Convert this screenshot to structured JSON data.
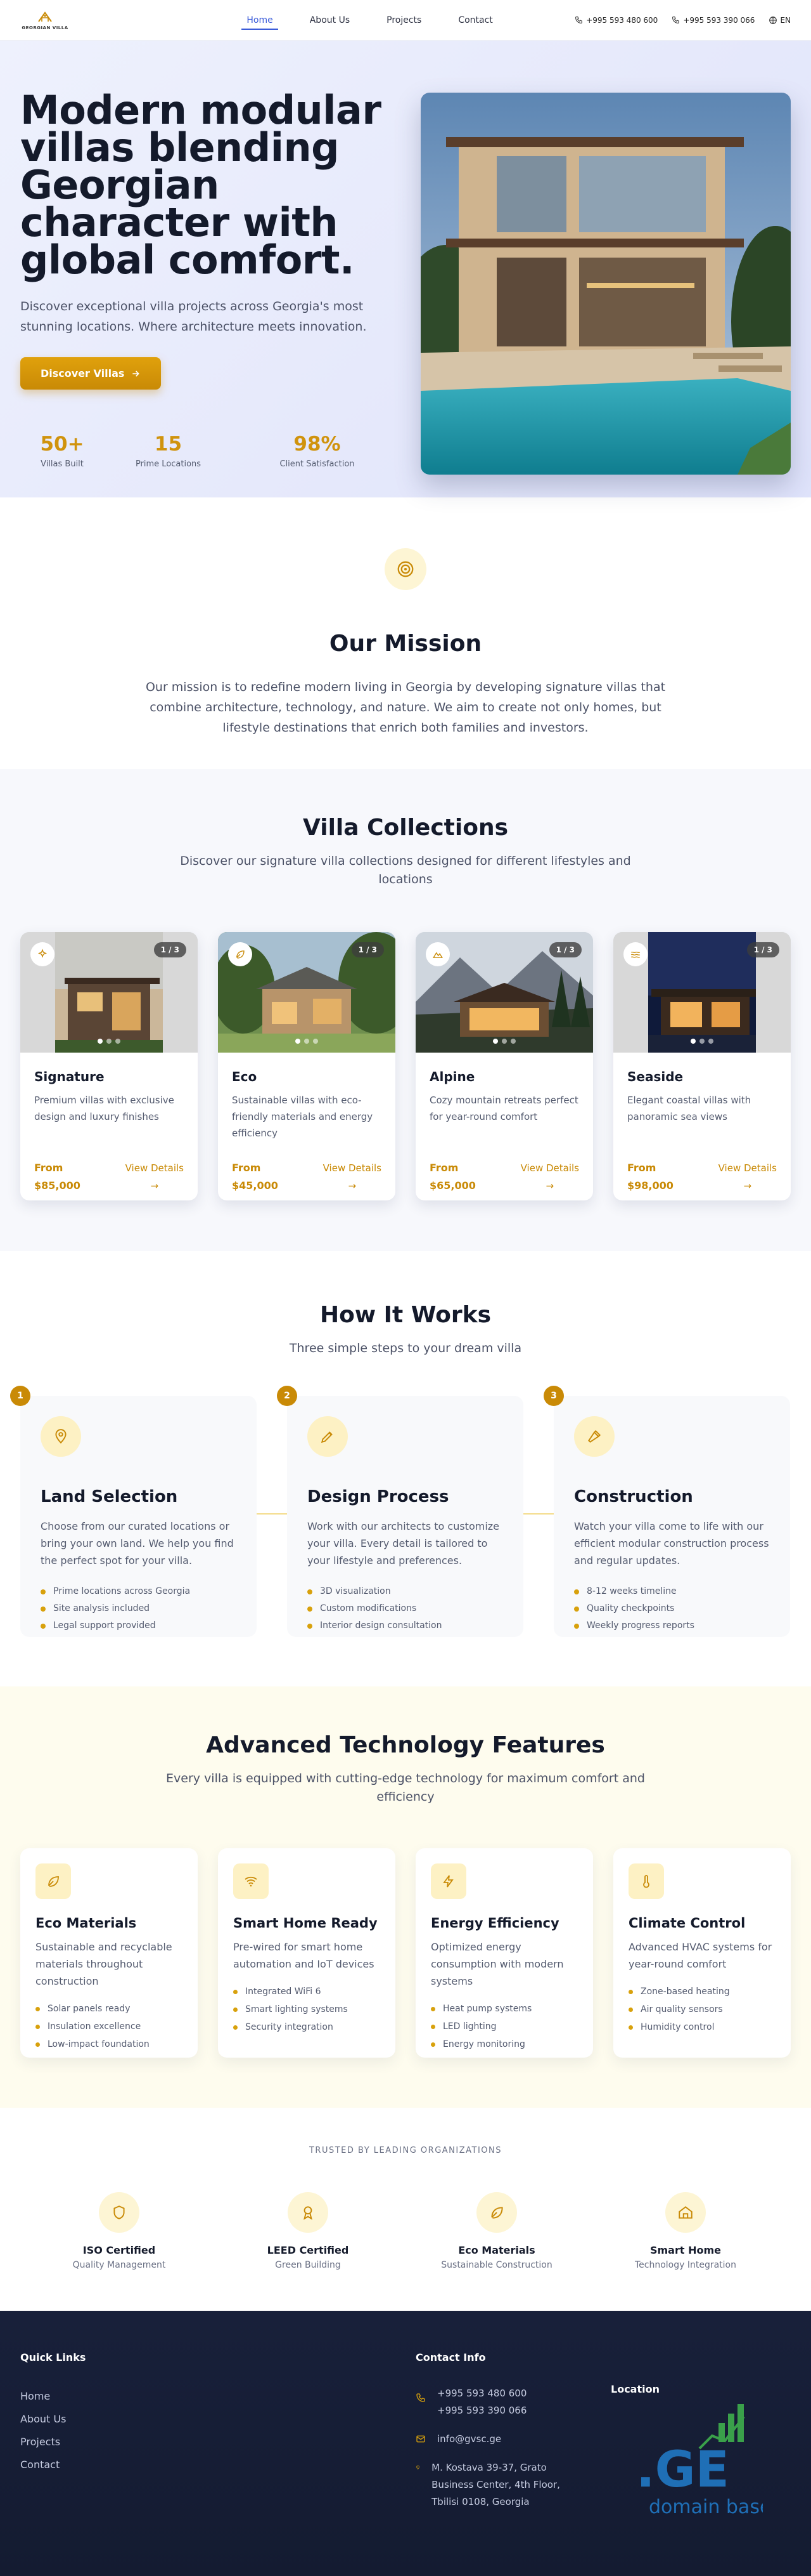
{
  "header": {
    "logo_text": "GEORGIAN VILLA",
    "nav": [
      {
        "label": "Home",
        "active": true
      },
      {
        "label": "About Us",
        "active": false
      },
      {
        "label": "Projects",
        "active": false
      },
      {
        "label": "Contact",
        "active": false
      }
    ],
    "phones": [
      "+995 593 480 600",
      "+995 593 390 066"
    ],
    "language": "EN"
  },
  "hero": {
    "title": "Modern modular villas blending Georgian character with global comfort.",
    "subtitle": "Discover exceptional villa projects across Georgia's most stunning locations. Where architecture meets innovation.",
    "cta_label": "Discover Villas",
    "stats": [
      {
        "value": "50+",
        "label": "Villas Built"
      },
      {
        "value": "15",
        "label": "Prime Locations"
      },
      {
        "value": "98%",
        "label": "Client Satisfaction"
      }
    ]
  },
  "mission": {
    "title": "Our Mission",
    "text": "Our mission is to redefine modern living in Georgia by developing signature villas that combine architecture, technology, and nature. We aim to create not only homes, but lifestyle destinations that enrich both families and investors."
  },
  "collections": {
    "title": "Villa Collections",
    "subtitle": "Discover our signature villa collections designed for different lifestyles and locations",
    "cards": [
      {
        "name": "Signature",
        "description": "Premium villas with exclusive design and luxury finishes",
        "price_label": "From",
        "price": "$85,000",
        "details_label": "View Details",
        "counter": "1 / 3",
        "icon": "sparkles-icon"
      },
      {
        "name": "Eco",
        "description": "Sustainable villas with eco-friendly materials and energy efficiency",
        "price_label": "From",
        "price": "$45,000",
        "details_label": "View Details",
        "counter": "1 / 3",
        "icon": "leaf-icon"
      },
      {
        "name": "Alpine",
        "description": "Cozy mountain retreats perfect for year-round comfort",
        "price_label": "From",
        "price": "$65,000",
        "details_label": "View Details",
        "counter": "1 / 3",
        "icon": "mountain-icon"
      },
      {
        "name": "Seaside",
        "description": "Elegant coastal villas with panoramic sea views",
        "price_label": "From",
        "price": "$98,000",
        "details_label": "View Details",
        "counter": "1 / 3",
        "icon": "waves-icon"
      }
    ]
  },
  "how": {
    "title": "How It Works",
    "subtitle": "Three simple steps to your dream villa",
    "steps": [
      {
        "number": "1",
        "title": "Land Selection",
        "description": "Choose from our curated locations or bring your own land. We help you find the perfect spot for your villa.",
        "items": [
          "Prime locations across Georgia",
          "Site analysis included",
          "Legal support provided"
        ],
        "icon": "map-pin-icon"
      },
      {
        "number": "2",
        "title": "Design Process",
        "description": "Work with our architects to customize your villa. Every detail is tailored to your lifestyle and preferences.",
        "items": [
          "3D visualization",
          "Custom modifications",
          "Interior design consultation"
        ],
        "icon": "pen-tool-icon"
      },
      {
        "number": "3",
        "title": "Construction",
        "description": "Watch your villa come to life with our efficient modular construction process and regular updates.",
        "items": [
          "8-12 weeks timeline",
          "Quality checkpoints",
          "Weekly progress reports"
        ],
        "icon": "hammer-icon"
      }
    ]
  },
  "tech": {
    "title": "Advanced Technology Features",
    "subtitle": "Every villa is equipped with cutting-edge technology for maximum comfort and efficiency",
    "cards": [
      {
        "title": "Eco Materials",
        "description": "Sustainable and recyclable materials throughout construction",
        "items": [
          "Solar panels ready",
          "Insulation excellence",
          "Low-impact foundation"
        ],
        "icon": "leaf-icon"
      },
      {
        "title": "Smart Home Ready",
        "description": "Pre-wired for smart home automation and IoT devices",
        "items": [
          "Integrated WiFi 6",
          "Smart lighting systems",
          "Security integration"
        ],
        "icon": "wifi-icon"
      },
      {
        "title": "Energy Efficiency",
        "description": "Optimized energy consumption with modern systems",
        "items": [
          "Heat pump systems",
          "LED lighting",
          "Energy monitoring"
        ],
        "icon": "lightning-icon"
      },
      {
        "title": "Climate Control",
        "description": "Advanced HVAC systems for year-round comfort",
        "items": [
          "Zone-based heating",
          "Air quality sensors",
          "Humidity control"
        ],
        "icon": "thermometer-icon"
      }
    ]
  },
  "trusted": {
    "title": "TRUSTED BY LEADING ORGANIZATIONS",
    "logos": [
      {
        "name": "ISO Certified",
        "sub": "Quality Management",
        "icon": "shield-icon"
      },
      {
        "name": "LEED Certified",
        "sub": "Green Building",
        "icon": "award-icon"
      },
      {
        "name": "Eco Materials",
        "sub": "Sustainable Construction",
        "icon": "leaf-icon"
      },
      {
        "name": "Smart Home",
        "sub": "Technology Integration",
        "icon": "home-icon"
      }
    ]
  },
  "footer": {
    "quick_links_title": "Quick Links",
    "links": [
      "Home",
      "About Us",
      "Projects",
      "Contact"
    ],
    "contact_title": "Contact Info",
    "phones": [
      "+995 593 480 600",
      "+995 593 390 066"
    ],
    "email": "info@gvsc.ge",
    "address": "M. Kostava 39-37, Grato Business Center, 4th Floor, Tbilisi 0108, Georgia",
    "location_title": "Location",
    "ge_logo_text": ".GE",
    "ge_logo_sub": "domain base"
  },
  "colors": {
    "accent": "#c98a06",
    "nav_active": "#3a5bd9",
    "dark": "#141a2b",
    "footer_bg": "#18203a"
  }
}
